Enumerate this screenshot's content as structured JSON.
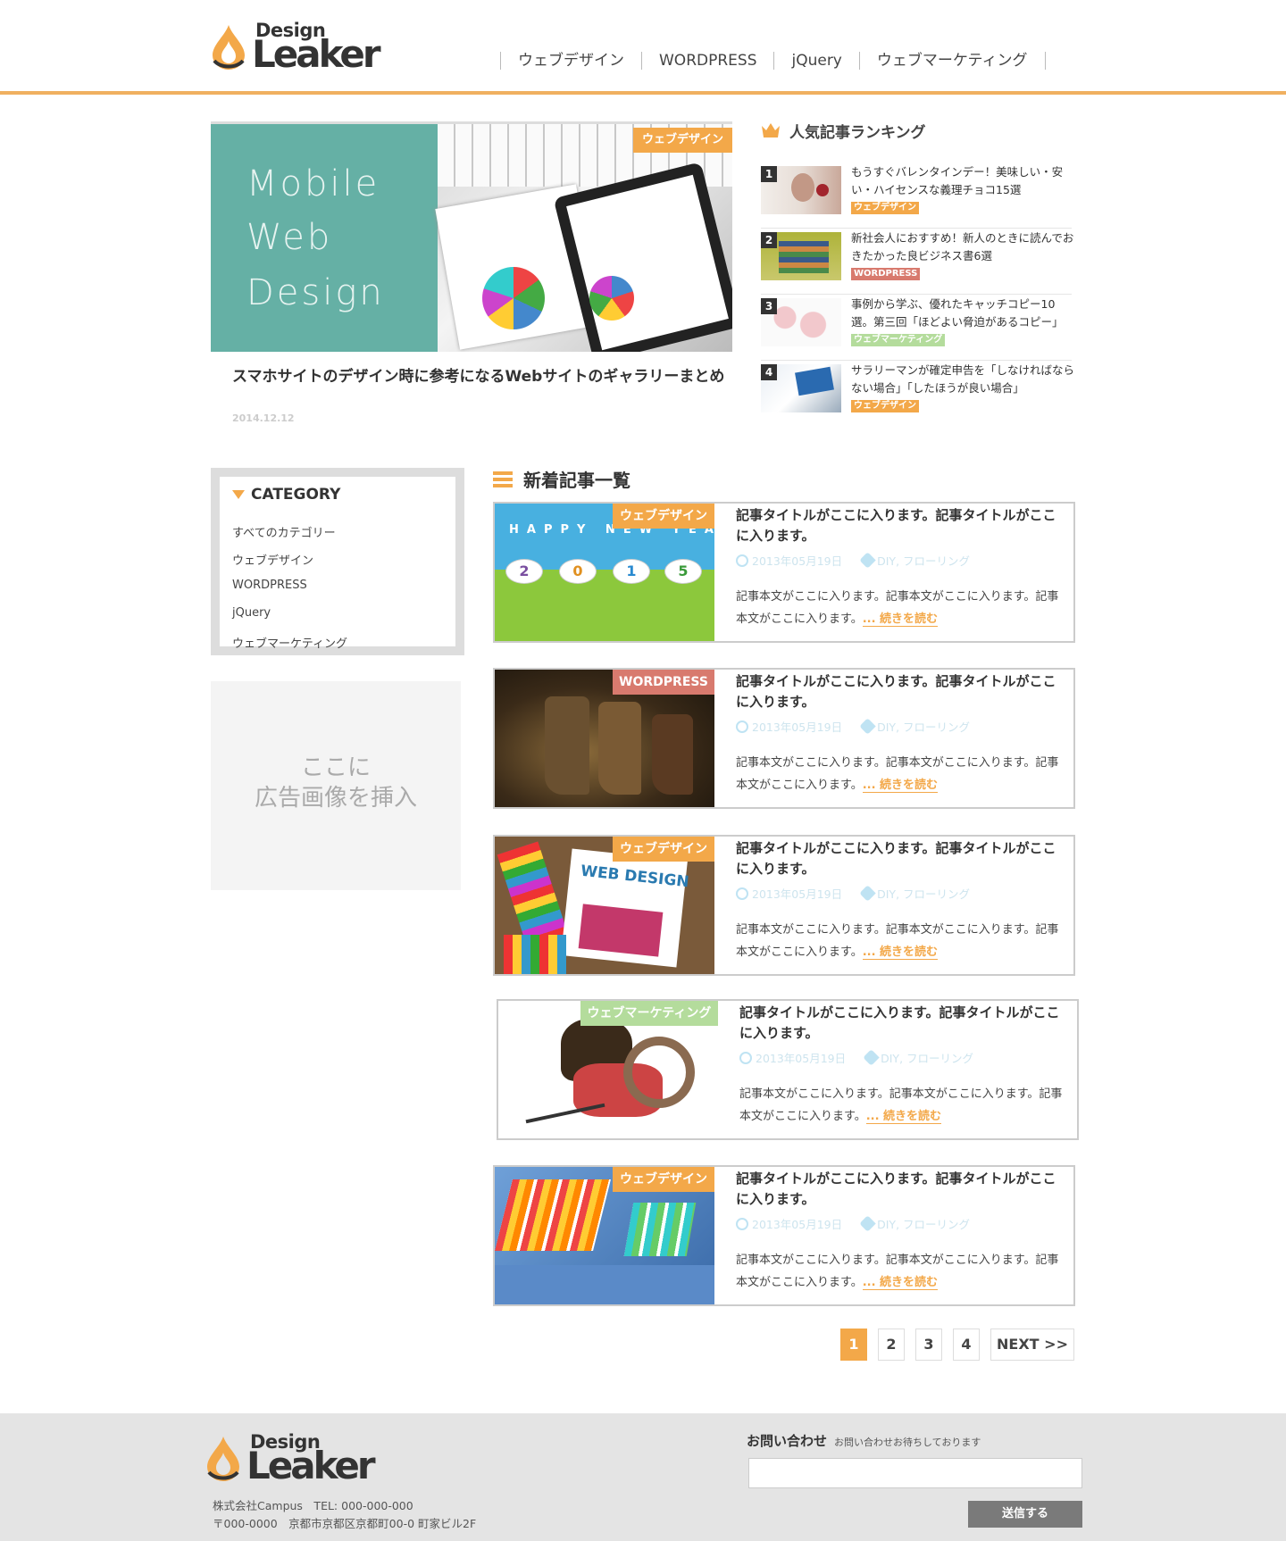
{
  "brand": {
    "logo_small": "Design",
    "logo_large": "Leaker"
  },
  "nav": [
    "ウェブデザイン",
    "WORDPRESS",
    "jQuery",
    "ウェブマーケティング"
  ],
  "hero": {
    "overlay_lines": [
      "Mobile",
      "Web",
      "Design"
    ],
    "tag": "ウェブデザイン",
    "title": "スマホサイトのデザイン時に参考になるWebサイトのギャラリーまとめ",
    "date": "2014.12.12"
  },
  "ranking": {
    "heading": "人気記事ランキング",
    "items": [
      {
        "rank": "1",
        "title": "もうすぐバレンタインデー！美味しい・安い・ハイセンスな義理チョコ15選",
        "tag": "ウェブデザイン"
      },
      {
        "rank": "2",
        "title": "新社会人におすすめ！新人のときに読んでおきたかった良ビジネス書6選",
        "tag": "WORDPRESS"
      },
      {
        "rank": "3",
        "title": "事例から学ぶ、優れたキャッチコピー10選。第三回「ほどよい脅迫があるコピー」",
        "tag": "ウェブマーケティング"
      },
      {
        "rank": "4",
        "title": "サラリーマンが確定申告を「しなければならない場合」「したほうが良い場合」",
        "tag": "ウェブデザイン"
      }
    ]
  },
  "category": {
    "heading": "CATEGORY",
    "items": [
      "すべてのカテゴリー",
      "ウェブデザイン",
      "WORDPRESS",
      "jQuery",
      "ウェブマーケティング"
    ]
  },
  "ad": {
    "line1": "ここに",
    "line2": "広告画像を挿入"
  },
  "articles": {
    "heading": "新着記事一覧",
    "items": [
      {
        "tag": "ウェブデザイン",
        "title": "記事タイトルがここに入ります。記事タイトルがここに入ります。",
        "date": "2013年05月19日",
        "tags": "DIY, フローリング",
        "body": "記事本文がここに入ります。記事本文がここに入ります。記事本文がここに入ります。",
        "more": "... 続きを読む",
        "img_text": "HAPPY NEW YEAR",
        "img_digits": [
          "2",
          "0",
          "1",
          "5"
        ]
      },
      {
        "tag": "WORDPRESS",
        "title": "記事タイトルがここに入ります。記事タイトルがここに入ります。",
        "date": "2013年05月19日",
        "tags": "DIY, フローリング",
        "body": "記事本文がここに入ります。記事本文がここに入ります。記事本文がここに入ります。",
        "more": "... 続きを読む"
      },
      {
        "tag": "ウェブデザイン",
        "title": "記事タイトルがここに入ります。記事タイトルがここに入ります。",
        "date": "2013年05月19日",
        "tags": "DIY, フローリング",
        "body": "記事本文がここに入ります。記事本文がここに入ります。記事本文がここに入ります。",
        "more": "... 続きを読む",
        "img_text": "WEB DESIGN"
      },
      {
        "tag": "ウェブマーケティング",
        "title": "記事タイトルがここに入ります。記事タイトルがここに入ります。",
        "date": "2013年05月19日",
        "tags": "DIY, フローリング",
        "body": "記事本文がここに入ります。記事本文がここに入ります。記事本文がここに入ります。",
        "more": "... 続きを読む"
      },
      {
        "tag": "ウェブデザイン",
        "title": "記事タイトルがここに入ります。記事タイトルがここに入ります。",
        "date": "2013年05月19日",
        "tags": "DIY, フローリング",
        "body": "記事本文がここに入ります。記事本文がここに入ります。記事本文がここに入ります。",
        "more": "... 続きを読む"
      }
    ]
  },
  "pagination": {
    "pages": [
      "1",
      "2",
      "3",
      "4"
    ],
    "current": "1",
    "next": "NEXT >>"
  },
  "footer": {
    "company": "株式会社Campus　TEL: 000-000-000",
    "address": "〒000-0000　京都市京都区京都町00-0 町家ビル2F",
    "contact_title": "お問い合わせ",
    "contact_sub": "お問い合わせお待ちしております",
    "submit": "送信する"
  },
  "colors": {
    "accent": "#f3a849",
    "wordpress": "#d87a6e",
    "marketing": "#b4dc9c",
    "hero_panel": "#65b0a5",
    "footer_bg": "#e4e4e4"
  }
}
